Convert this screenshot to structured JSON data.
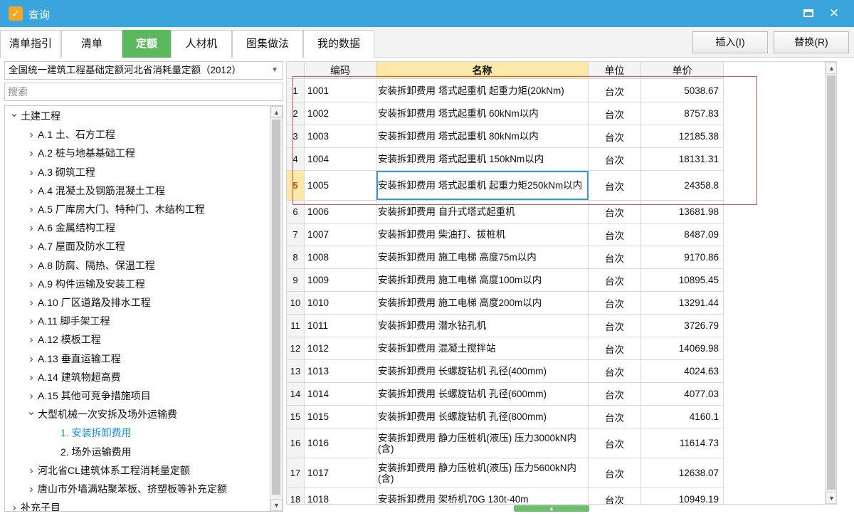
{
  "window": {
    "title": "查询",
    "maximize_label": "",
    "close_label": "✕"
  },
  "tabs": [
    {
      "label": "清单指引",
      "active": false
    },
    {
      "label": "清单",
      "active": false
    },
    {
      "label": "定额",
      "active": true
    },
    {
      "label": "人材机",
      "active": false
    },
    {
      "label": "图集做法",
      "active": false
    },
    {
      "label": "我的数据",
      "active": false
    }
  ],
  "toolbar": {
    "insert_label": "插入(I)",
    "replace_label": "替换(R)"
  },
  "left": {
    "dropdown_value": "全国统一建筑工程基础定额河北省消耗量定额（2012）",
    "search_placeholder": "搜索",
    "tree": [
      {
        "label": "土建工程",
        "level": 0,
        "expanded": true
      },
      {
        "label": "A.1 土、石方工程",
        "level": 1
      },
      {
        "label": "A.2 桩与地基基础工程",
        "level": 1
      },
      {
        "label": "A.3 砌筑工程",
        "level": 1
      },
      {
        "label": "A.4 混凝土及钢筋混凝土工程",
        "level": 1
      },
      {
        "label": "A.5 厂库房大门、特种门、木结构工程",
        "level": 1
      },
      {
        "label": "A.6 金属结构工程",
        "level": 1
      },
      {
        "label": "A.7 屋面及防水工程",
        "level": 1
      },
      {
        "label": "A.8 防腐、隔热、保温工程",
        "level": 1
      },
      {
        "label": "A.9 构件运输及安装工程",
        "level": 1
      },
      {
        "label": "A.10 厂区道路及排水工程",
        "level": 1
      },
      {
        "label": "A.11 脚手架工程",
        "level": 1
      },
      {
        "label": "A.12 模板工程",
        "level": 1
      },
      {
        "label": "A.13 垂直运输工程",
        "level": 1
      },
      {
        "label": "A.14 建筑物超高费",
        "level": 1
      },
      {
        "label": "A.15 其他可竞争措施项目",
        "level": 1
      },
      {
        "label": "大型机械一次安拆及场外运输费",
        "level": 1,
        "expanded": true
      },
      {
        "label": "1. 安装拆卸费用",
        "level": 2,
        "selected": true
      },
      {
        "label": "2. 场外运输费用",
        "level": 2
      },
      {
        "label": "河北省CL建筑体系工程消耗量定额",
        "level": 1
      },
      {
        "label": "唐山市外墙满粘聚苯板、挤塑板等补充定额",
        "level": 1
      },
      {
        "label": "补充子目",
        "level": 0
      }
    ]
  },
  "grid": {
    "headers": {
      "index": "",
      "code": "编码",
      "name": "名称",
      "unit": "单位",
      "price": "单价"
    },
    "rows": [
      {
        "index": "1",
        "code": "1001",
        "name": "安装拆卸费用 塔式起重机 起重力矩(20kNm)",
        "unit": "台次",
        "price": "5038.67"
      },
      {
        "index": "2",
        "code": "1002",
        "name": "安装拆卸费用 塔式起重机 60kNm以内",
        "unit": "台次",
        "price": "8757.83"
      },
      {
        "index": "3",
        "code": "1003",
        "name": "安装拆卸费用 塔式起重机 80kNm以内",
        "unit": "台次",
        "price": "12185.38"
      },
      {
        "index": "4",
        "code": "1004",
        "name": "安装拆卸费用 塔式起重机 150kNm以内",
        "unit": "台次",
        "price": "18131.31"
      },
      {
        "index": "5",
        "code": "1005",
        "name": "安装拆卸费用 塔式起重机 起重力矩250kNm以内",
        "unit": "台次",
        "price": "24358.8"
      },
      {
        "index": "6",
        "code": "1006",
        "name": "安装拆卸费用 自升式塔式起重机",
        "unit": "台次",
        "price": "13681.98"
      },
      {
        "index": "7",
        "code": "1007",
        "name": "安装拆卸费用 柴油打、拔桩机",
        "unit": "台次",
        "price": "8487.09"
      },
      {
        "index": "8",
        "code": "1008",
        "name": "安装拆卸费用 施工电梯 高度75m以内",
        "unit": "台次",
        "price": "9170.86"
      },
      {
        "index": "9",
        "code": "1009",
        "name": "安装拆卸费用 施工电梯 高度100m以内",
        "unit": "台次",
        "price": "10895.45"
      },
      {
        "index": "10",
        "code": "1010",
        "name": "安装拆卸费用 施工电梯 高度200m以内",
        "unit": "台次",
        "price": "13291.44"
      },
      {
        "index": "11",
        "code": "1011",
        "name": "安装拆卸费用 潜水钻孔机",
        "unit": "台次",
        "price": "3726.79"
      },
      {
        "index": "12",
        "code": "1012",
        "name": "安装拆卸费用 混凝土搅拌站",
        "unit": "台次",
        "price": "14069.98"
      },
      {
        "index": "13",
        "code": "1013",
        "name": "安装拆卸费用 长螺旋钻机 孔径(400mm)",
        "unit": "台次",
        "price": "4024.63"
      },
      {
        "index": "14",
        "code": "1014",
        "name": "安装拆卸费用 长螺旋钻机 孔径(600mm)",
        "unit": "台次",
        "price": "4077.03"
      },
      {
        "index": "15",
        "code": "1015",
        "name": "安装拆卸费用 长螺旋钻机 孔径(800mm)",
        "unit": "台次",
        "price": "4160.1"
      },
      {
        "index": "16",
        "code": "1016",
        "name": "安装拆卸费用 静力压桩机(液压) 压力3000kN内(含)",
        "unit": "台次",
        "price": "11614.73"
      },
      {
        "index": "17",
        "code": "1017",
        "name": "安装拆卸费用 静力压桩机(液压) 压力5600kN内(含)",
        "unit": "台次",
        "price": "12638.07"
      },
      {
        "index": "18",
        "code": "1018",
        "name": "安装拆卸费用 架桥机70G 130t-40m",
        "unit": "台次",
        "price": "10949.19"
      }
    ],
    "current_row": 5
  },
  "colors": {
    "titlebar": "#3aa4dd",
    "active_tab": "#5bb85d",
    "header_highlight": "#fde8a8",
    "selection_blue": "#1a8fdc",
    "redbox": "#e05050"
  }
}
